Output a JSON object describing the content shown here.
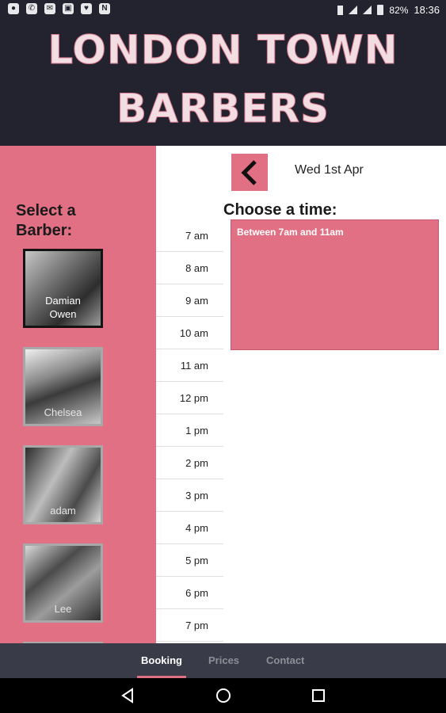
{
  "status_bar": {
    "notification_icons": [
      "app-icon",
      "phone-icon",
      "mail-icon",
      "twitch-icon",
      "heart-icon",
      "n-icon"
    ],
    "battery": "82%",
    "time": "18:36"
  },
  "header": {
    "logo_line1": "LONDON TOWN",
    "logo_line2": "BARBERS"
  },
  "sidebar": {
    "title_line1": "Select a",
    "title_line2": "Barber:",
    "barbers": [
      {
        "name": "Damian\nOwen",
        "selected": true
      },
      {
        "name": "Chelsea",
        "selected": false
      },
      {
        "name": "adam",
        "selected": false
      },
      {
        "name": "Lee",
        "selected": false
      }
    ]
  },
  "booking": {
    "date": "Wed 1st Apr",
    "choose_title": "Choose a time:",
    "slot_text": "Between 7am and 11am",
    "times": [
      "7 am",
      "8 am",
      "9 am",
      "10 am",
      "11 am",
      "12 pm",
      "1 pm",
      "2 pm",
      "3 pm",
      "4 pm",
      "5 pm",
      "6 pm",
      "7 pm"
    ]
  },
  "tabs": {
    "booking": "Booking",
    "prices": "Prices",
    "contact": "Contact",
    "active": "Booking"
  },
  "colors": {
    "accent": "#e27084",
    "header_bg": "#22232f",
    "tab_bg": "#3a3b48"
  }
}
